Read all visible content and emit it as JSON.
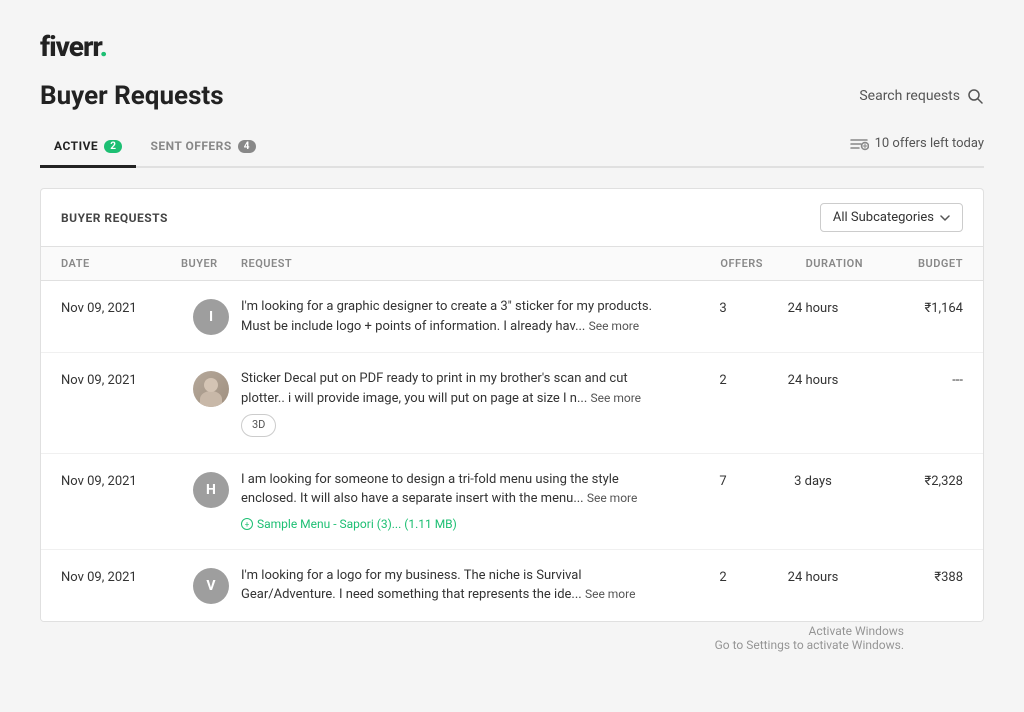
{
  "logo": {
    "text": "fiverr",
    "dot": "."
  },
  "page": {
    "title": "Buyer Requests"
  },
  "search": {
    "placeholder": "Search requests",
    "label": "Search requests"
  },
  "tabs": [
    {
      "id": "active",
      "label": "ACTIVE",
      "badge": "2",
      "active": true
    },
    {
      "id": "sent-offers",
      "label": "SENT OFFERS",
      "badge": "4",
      "active": false
    }
  ],
  "offers_left": {
    "count": "10",
    "label": "10 offers left today"
  },
  "table": {
    "section_title": "BUYER REQUESTS",
    "subcategory_label": "All Subcategories",
    "columns": [
      "DATE",
      "BUYER",
      "REQUEST",
      "OFFERS",
      "DURATION",
      "BUDGET"
    ],
    "rows": [
      {
        "date": "Nov 09, 2021",
        "buyer_initial": "I",
        "buyer_color": "gray",
        "request": "I'm looking for a graphic designer to create a 3\" sticker for my products. Must be include logo + points of information. I already hav...",
        "see_more": "See more",
        "offers": "3",
        "duration": "24 hours",
        "budget": "₹1,164",
        "tag": null,
        "attachment": null
      },
      {
        "date": "Nov 09, 2021",
        "buyer_initial": "photo",
        "buyer_color": "photo",
        "request": "Sticker Decal put on PDF ready to print in my brother's scan and cut plotter.. i will provide image, you will put on page at size I n...",
        "see_more": "See more",
        "offers": "2",
        "duration": "24 hours",
        "budget": "---",
        "tag": "3D",
        "attachment": null
      },
      {
        "date": "Nov 09, 2021",
        "buyer_initial": "H",
        "buyer_color": "gray",
        "request": "I am looking for someone to design a tri-fold menu using the style enclosed. It will also have a separate insert with the menu...",
        "see_more": "See more",
        "offers": "7",
        "duration": "3 days",
        "budget": "₹2,328",
        "tag": null,
        "attachment": "Sample Menu - Sapori (3)...  (1.11 MB)"
      },
      {
        "date": "Nov 09, 2021",
        "buyer_initial": "V",
        "buyer_color": "gray",
        "request": "I'm looking for a logo for my business. The niche is Survival Gear/Adventure. I need something that represents the ide...",
        "see_more": "See more",
        "offers": "2",
        "duration": "24 hours",
        "budget": "₹388",
        "tag": null,
        "attachment": null
      }
    ]
  },
  "activate_windows": {
    "line1": "Activate Windows",
    "line2": "Go to Settings to activate Windows."
  }
}
